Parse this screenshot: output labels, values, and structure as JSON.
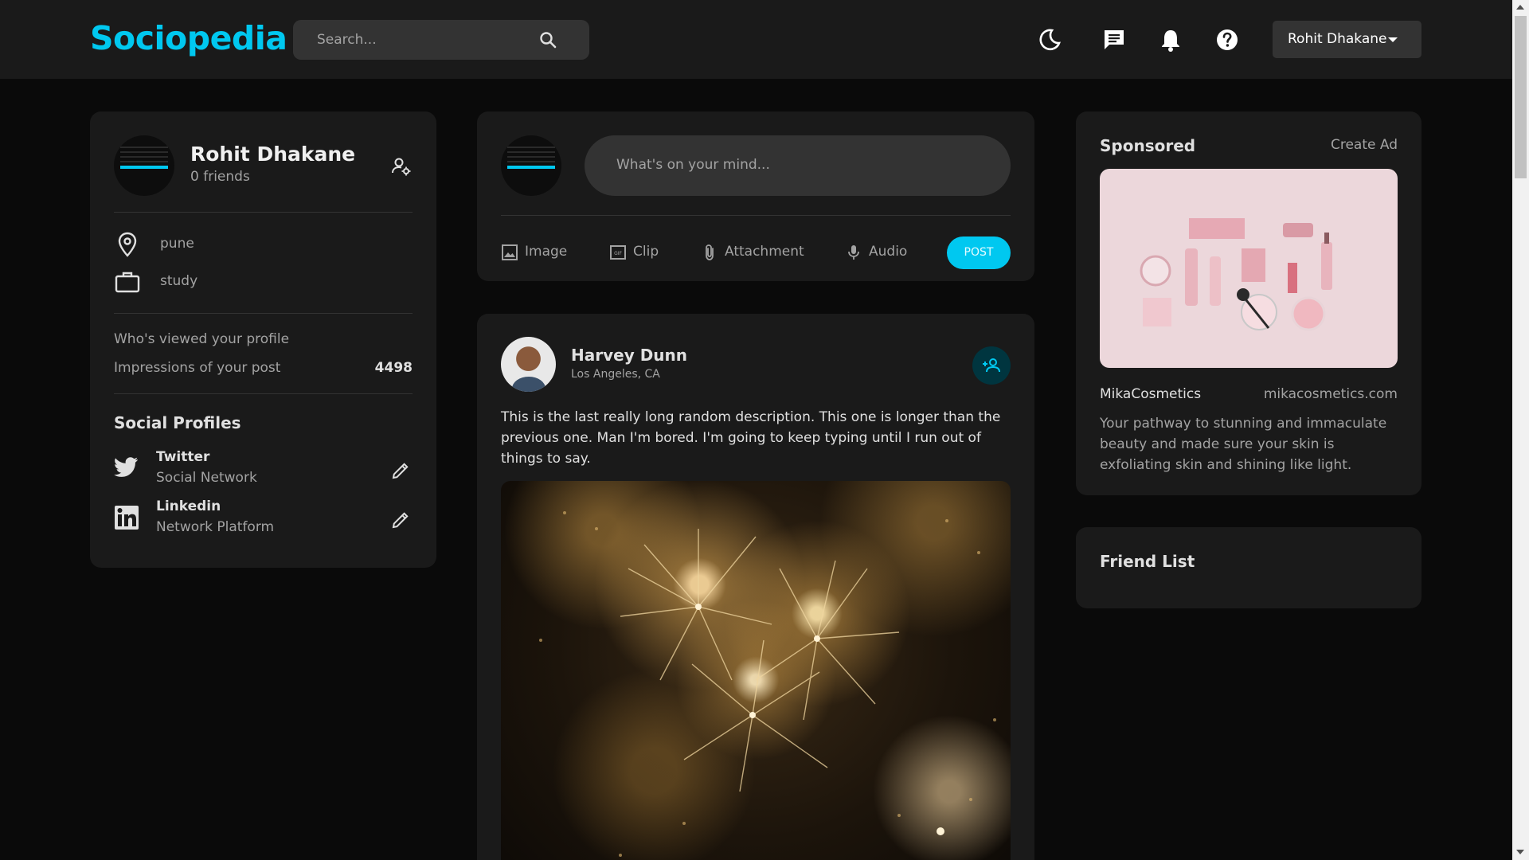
{
  "navbar": {
    "logo": "Sociopedia",
    "search_placeholder": "Search...",
    "user_name": "Rohit Dhakane"
  },
  "profile": {
    "name": "Rohit Dhakane",
    "friends": "0 friends",
    "location": "pune",
    "occupation": "study",
    "viewed_label": "Who's viewed your profile",
    "impressions_label": "Impressions of your post",
    "impressions_value": "4498",
    "social_title": "Social Profiles",
    "socials": [
      {
        "name": "Twitter",
        "type": "Social Network",
        "icon": "twitter-icon"
      },
      {
        "name": "Linkedin",
        "type": "Network Platform",
        "icon": "linkedin-icon"
      }
    ]
  },
  "create_post": {
    "placeholder": "What's on your mind...",
    "actions": [
      "Image",
      "Clip",
      "Attachment",
      "Audio"
    ],
    "post_label": "POST"
  },
  "feed": {
    "posts": [
      {
        "author": "Harvey Dunn",
        "location": "Los Angeles, CA",
        "description": "This is the last really long random description. This one is longer than the previous one. Man I'm bored. I'm going to keep typing until I run out of things to say."
      }
    ]
  },
  "sponsored": {
    "title": "Sponsored",
    "create_ad": "Create Ad",
    "brand": "MikaCosmetics",
    "url": "mikacosmetics.com",
    "description": "Your pathway to stunning and immaculate beauty and made sure your skin is exfoliating skin and shining like light."
  },
  "friend_list": {
    "title": "Friend List"
  },
  "colors": {
    "accent": "#00c8f0",
    "background": "#0a0a0a",
    "card": "#1a1a1a",
    "input": "#333333"
  }
}
